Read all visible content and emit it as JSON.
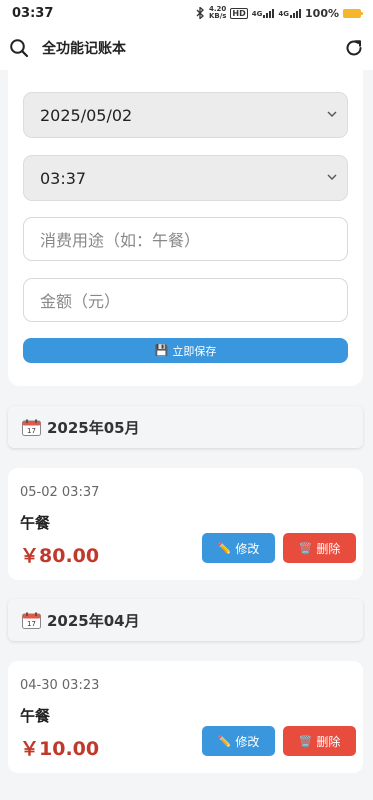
{
  "status": {
    "time": "03:37",
    "bluetooth_icon": "bluetooth-icon",
    "speed_value": "4.20",
    "speed_unit": "KB/s",
    "hd_label": "HD",
    "net1": "4G",
    "net2": "4G",
    "battery_pct": "100%",
    "battery_color": "#f5b52e"
  },
  "appbar": {
    "title": "全功能记账本",
    "search_icon": "search-icon",
    "refresh_icon": "refresh-icon"
  },
  "form": {
    "date_value": "2025/05/02",
    "time_value": "03:37",
    "purpose_placeholder": "消费用途（如：午餐）",
    "amount_placeholder": "金额（元）",
    "save_icon": "💾",
    "save_label": "立即保存"
  },
  "groups": [
    {
      "month": "2025年05月",
      "records": [
        {
          "time": "05-02 03:37",
          "purpose": "午餐",
          "amount": "￥80.00",
          "edit_icon": "✏️",
          "edit_label": "修改",
          "delete_icon": "🗑️",
          "delete_label": "删除"
        }
      ]
    },
    {
      "month": "2025年04月",
      "records": [
        {
          "time": "04-30 03:23",
          "purpose": "午餐",
          "amount": "￥10.00",
          "edit_icon": "✏️",
          "edit_label": "修改",
          "delete_icon": "🗑️",
          "delete_label": "删除"
        }
      ]
    }
  ],
  "colors": {
    "primary": "#3a97de",
    "danger": "#e74c3c",
    "amount": "#c0392b"
  }
}
